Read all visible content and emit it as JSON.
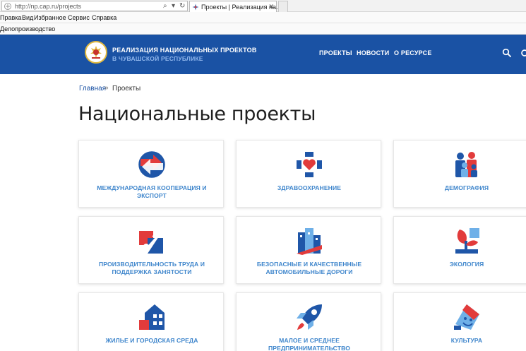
{
  "browser": {
    "url": "http://np.cap.ru/projects",
    "tab_title": "Проекты | Реализация на...",
    "menu": [
      "Правка",
      "Вид",
      "Избранное",
      "Сервис",
      "Справка"
    ],
    "favorites": [
      "Делопроизводство"
    ]
  },
  "header": {
    "brand_line1": "РЕАЛИЗАЦИЯ НАЦИОНАЛЬНЫХ ПРОЕКТОВ",
    "brand_line2": "В ЧУВАШСКОЙ РЕСПУБЛИКЕ",
    "nav": [
      "ПРОЕКТЫ",
      "НОВОСТИ",
      "О РЕСУРСЕ"
    ],
    "icons": [
      "search-icon",
      "user-icon"
    ],
    "colors": {
      "background": "#1a52a4",
      "accent": "#8fb6ec"
    }
  },
  "breadcrumb": {
    "home": "Главная",
    "separator": "»",
    "current": "Проекты"
  },
  "page": {
    "title": "Национальные проекты"
  },
  "projects": [
    {
      "label": "МЕЖДУНАРОДНАЯ КООПЕРАЦИЯ И ЭКСПОРТ",
      "icon": "globe-arrows-icon"
    },
    {
      "label": "ЗДРАВООХРАНЕНИЕ",
      "icon": "medical-cross-heart-icon"
    },
    {
      "label": "ДЕМОГРАФИЯ",
      "icon": "family-icon"
    },
    {
      "label": "ПРОИЗВОДИТЕЛЬНОСТЬ ТРУДА И ПОДДЕРЖКА ЗАНЯТОСТИ",
      "icon": "growth-arrow-icon"
    },
    {
      "label": "БЕЗОПАСНЫЕ И КАЧЕСТВЕННЫЕ АВТОМОБИЛЬНЫЕ ДОРОГИ",
      "icon": "city-road-icon"
    },
    {
      "label": "ЭКОЛОГИЯ",
      "icon": "plant-icon"
    },
    {
      "label": "ЖИЛЬЕ И ГОРОДСКАЯ СРЕДА",
      "icon": "house-icon"
    },
    {
      "label": "МАЛОЕ И СРЕДНЕЕ ПРЕДПРИНИМАТЕЛЬСТВО",
      "icon": "rocket-icon"
    },
    {
      "label": "КУЛЬТУРА",
      "icon": "theatre-mask-icon"
    }
  ]
}
